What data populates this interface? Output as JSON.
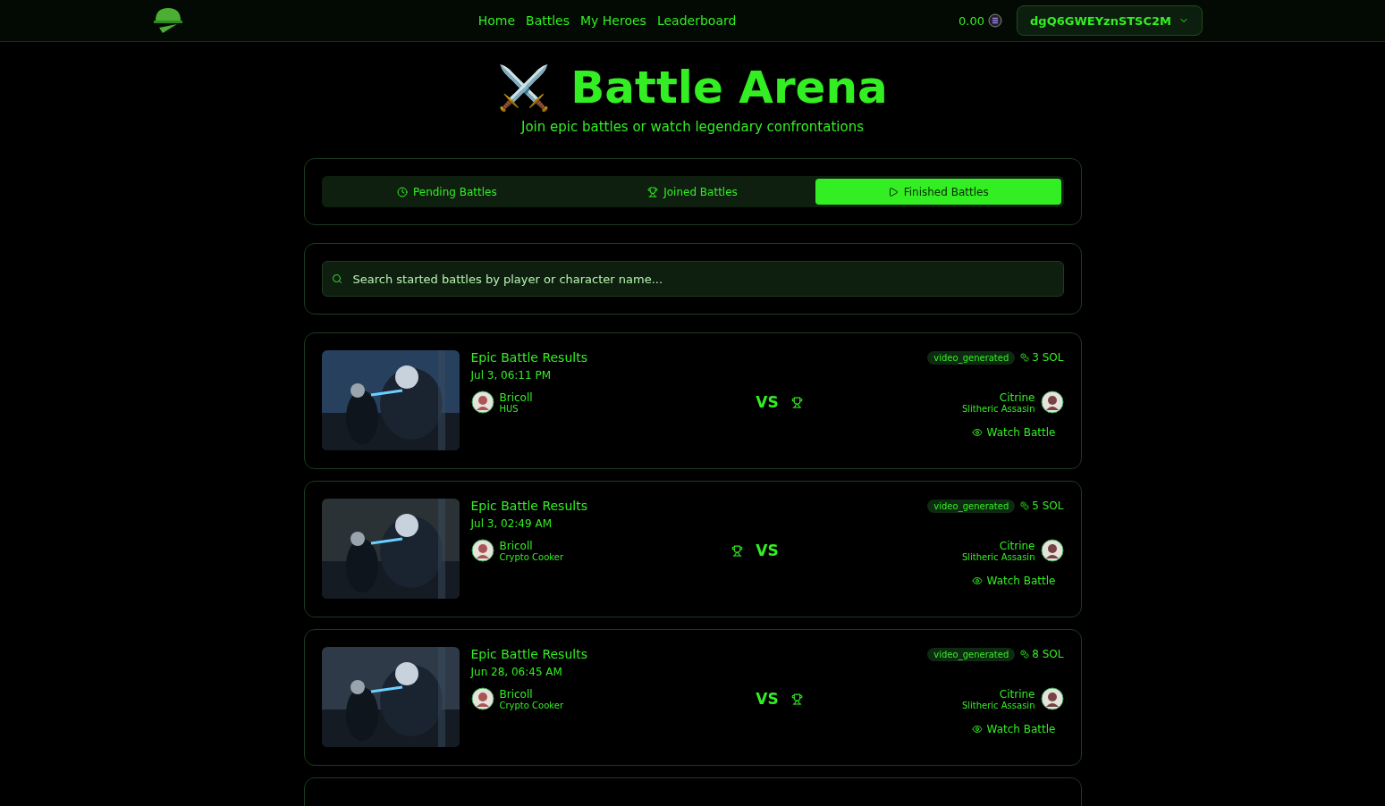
{
  "nav": {
    "links": [
      "Home",
      "Battles",
      "My Heroes",
      "Leaderboard"
    ],
    "balance": "0.00",
    "wallet": "dgQ6GWEYznSTSC2M"
  },
  "hero": {
    "icon": "⚔️",
    "title": "Battle Arena",
    "subtitle": "Join epic battles or watch legendary confrontations"
  },
  "tabs": [
    {
      "label": "Pending Battles",
      "selected": false
    },
    {
      "label": "Joined Battles",
      "selected": false
    },
    {
      "label": "Finished Battles",
      "selected": true
    }
  ],
  "search": {
    "placeholder": "Search started battles by player or character name..."
  },
  "battles": [
    {
      "title": "Epic Battle Results",
      "date": "Jul 3, 06:11 PM",
      "status": "video_generated",
      "prize": "3 SOL",
      "vs": "VS",
      "player_won": false,
      "player": {
        "name": "Bricoll",
        "character": "HUS"
      },
      "opponent": {
        "name": "Citrine",
        "character": "Slitheric Assasin"
      },
      "action": "Watch Battle"
    },
    {
      "title": "Epic Battle Results",
      "date": "Jul 3, 02:49 AM",
      "status": "video_generated",
      "prize": "5 SOL",
      "vs": "VS",
      "player_won": true,
      "player": {
        "name": "Bricoll",
        "character": "Crypto Cooker"
      },
      "opponent": {
        "name": "Citrine",
        "character": "Slitheric Assasin"
      },
      "action": "Watch Battle"
    },
    {
      "title": "Epic Battle Results",
      "date": "Jun 28, 06:45 AM",
      "status": "video_generated",
      "prize": "8 SOL",
      "vs": "VS",
      "player_won": false,
      "player": {
        "name": "Bricoll",
        "character": "Crypto Cooker"
      },
      "opponent": {
        "name": "Citrine",
        "character": "Slitheric Assasin"
      },
      "action": "Watch Battle"
    }
  ]
}
